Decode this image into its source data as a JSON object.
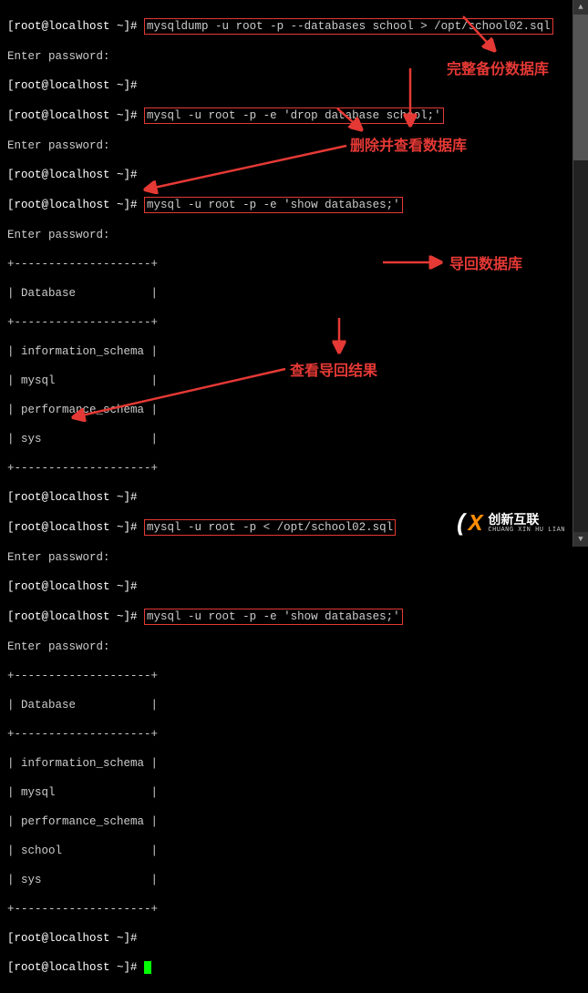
{
  "terminal": {
    "prompt": "[root@localhost ~]#",
    "enterpw": "Enter password:",
    "divider": "+--------------------+",
    "dbHeader": "| Database           |",
    "cmd1": "mysqldump -u root -p --databases school > /opt/school02.sql",
    "cmd2": "mysql -u root -p -e 'drop database school;'",
    "cmd3": "mysql -u root -p -e 'show databases;'",
    "cmd4": "mysql -u root -p < /opt/school02.sql",
    "cmd5": "mysql -u root -p -e 'show databases;'",
    "dbList1": [
      "| information_schema |",
      "| mysql              |",
      "| performance_schema |",
      "| sys                |"
    ],
    "dbList2": [
      "| information_schema |",
      "| mysql              |",
      "| performance_schema |",
      "| school             |",
      "| sys                |"
    ]
  },
  "annotations": {
    "a1": "完整备份数据库",
    "a2": "删除并查看数据库",
    "a3": "导回数据库",
    "a4": "查看导回结果"
  },
  "logo": {
    "cn": "创新互联",
    "py": "CHUANG XIN HU LIAN"
  }
}
